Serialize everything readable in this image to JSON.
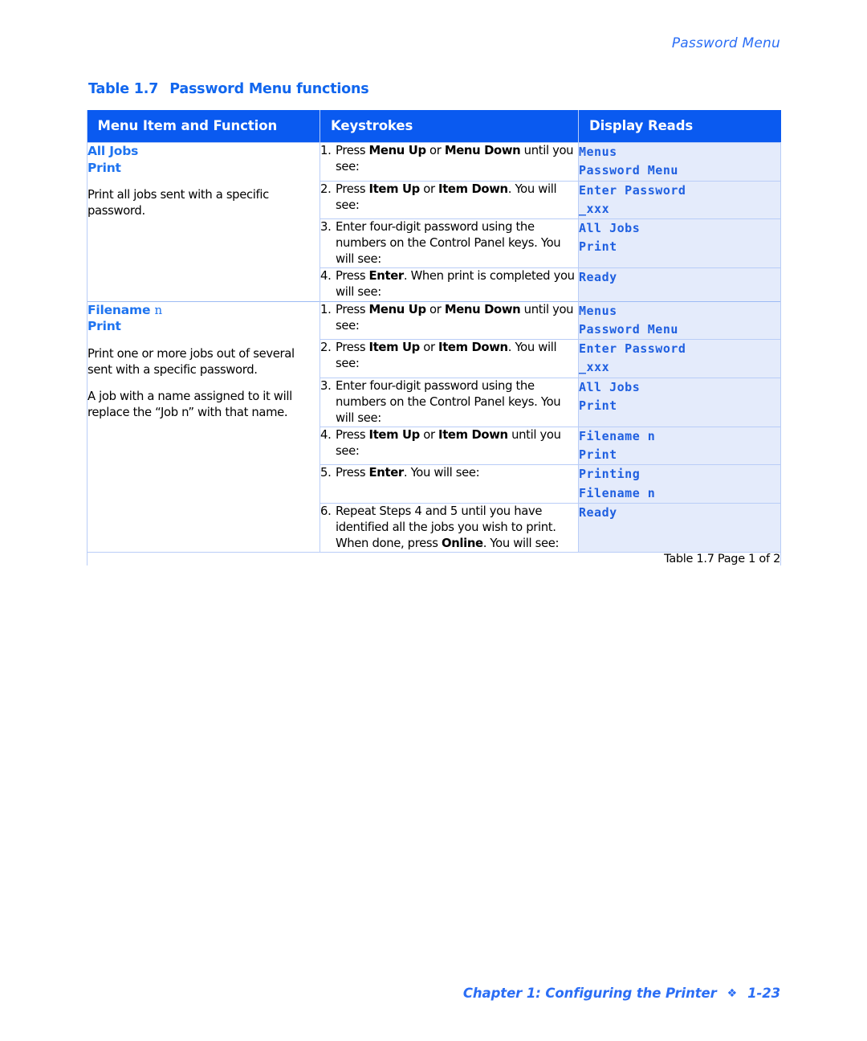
{
  "header": {
    "running_head": "Password Menu"
  },
  "caption": {
    "number": "Table 1.7",
    "title": "Password Menu functions"
  },
  "table": {
    "columns": [
      "Menu Item and Function",
      "Keystrokes",
      "Display Reads"
    ],
    "sections": [
      {
        "menu": {
          "title_bold": "All Jobs",
          "title_regular": "",
          "subtitle": "Print",
          "paragraphs": [
            "Print all jobs sent with a specific password."
          ]
        },
        "rows": [
          {
            "num": "1.",
            "keystroke_html": "Press <b>Menu Up</b> or <b>Menu Down</b> until you see:",
            "display": [
              "Menus",
              "Password Menu"
            ]
          },
          {
            "num": "2.",
            "keystroke_html": "Press <b>Item Up</b> or <b>Item Down</b>. You will see:",
            "display": [
              "Enter Password",
              "_xxx"
            ]
          },
          {
            "num": "3.",
            "keystroke_html": "Enter four-digit password using the numbers on the Control Panel keys. You will see:",
            "display": [
              "All Jobs",
              "Print"
            ]
          },
          {
            "num": "4.",
            "keystroke_html": "Press <b>Enter</b>. When print is completed you will see:",
            "display": [
              "Ready"
            ]
          }
        ]
      },
      {
        "menu": {
          "title_bold": "Filename",
          "title_regular": "n",
          "subtitle": "Print",
          "paragraphs": [
            "Print one or more jobs out of several sent with a specific password.",
            "A job with a name assigned to it will replace the “Job n” with that name."
          ]
        },
        "rows": [
          {
            "num": "1.",
            "keystroke_html": "Press <b>Menu Up</b> or <b>Menu Down</b> until you see:",
            "display": [
              "Menus",
              "Password Menu"
            ]
          },
          {
            "num": "2.",
            "keystroke_html": "Press <b>Item Up</b> or <b>Item Down</b>. You will see:",
            "display": [
              "Enter Password",
              "_xxx"
            ]
          },
          {
            "num": "3.",
            "keystroke_html": "Enter four-digit password using the numbers on the Control Panel keys. You will see:",
            "display": [
              "All Jobs",
              "Print"
            ]
          },
          {
            "num": "4.",
            "keystroke_html": "Press <b>Item Up</b> or <b>Item Down</b> until you see:",
            "display": [
              "Filename n",
              "Print"
            ]
          },
          {
            "num": "5.",
            "keystroke_html": "Press <b>Enter</b>. You will see:",
            "display": [
              "Printing",
              "Filename n"
            ]
          },
          {
            "num": "6.",
            "keystroke_html": "Repeat Steps 4 and 5 until you have identified all the jobs you wish to print. When done, press <b>Online</b>. You will see:",
            "display": [
              "Ready"
            ]
          }
        ]
      }
    ],
    "footnote": "Table 1.7  Page 1 of 2"
  },
  "footer": {
    "chapter": "Chapter 1: Configuring the Printer",
    "ornament": "❖",
    "page": "1-23"
  },
  "colors": {
    "header_blue": "#0a5af0",
    "accent_blue": "#1f74f0",
    "display_bg": "#e4ebfb",
    "display_text": "#1f5fe0",
    "rule": "#b9cdf7"
  }
}
